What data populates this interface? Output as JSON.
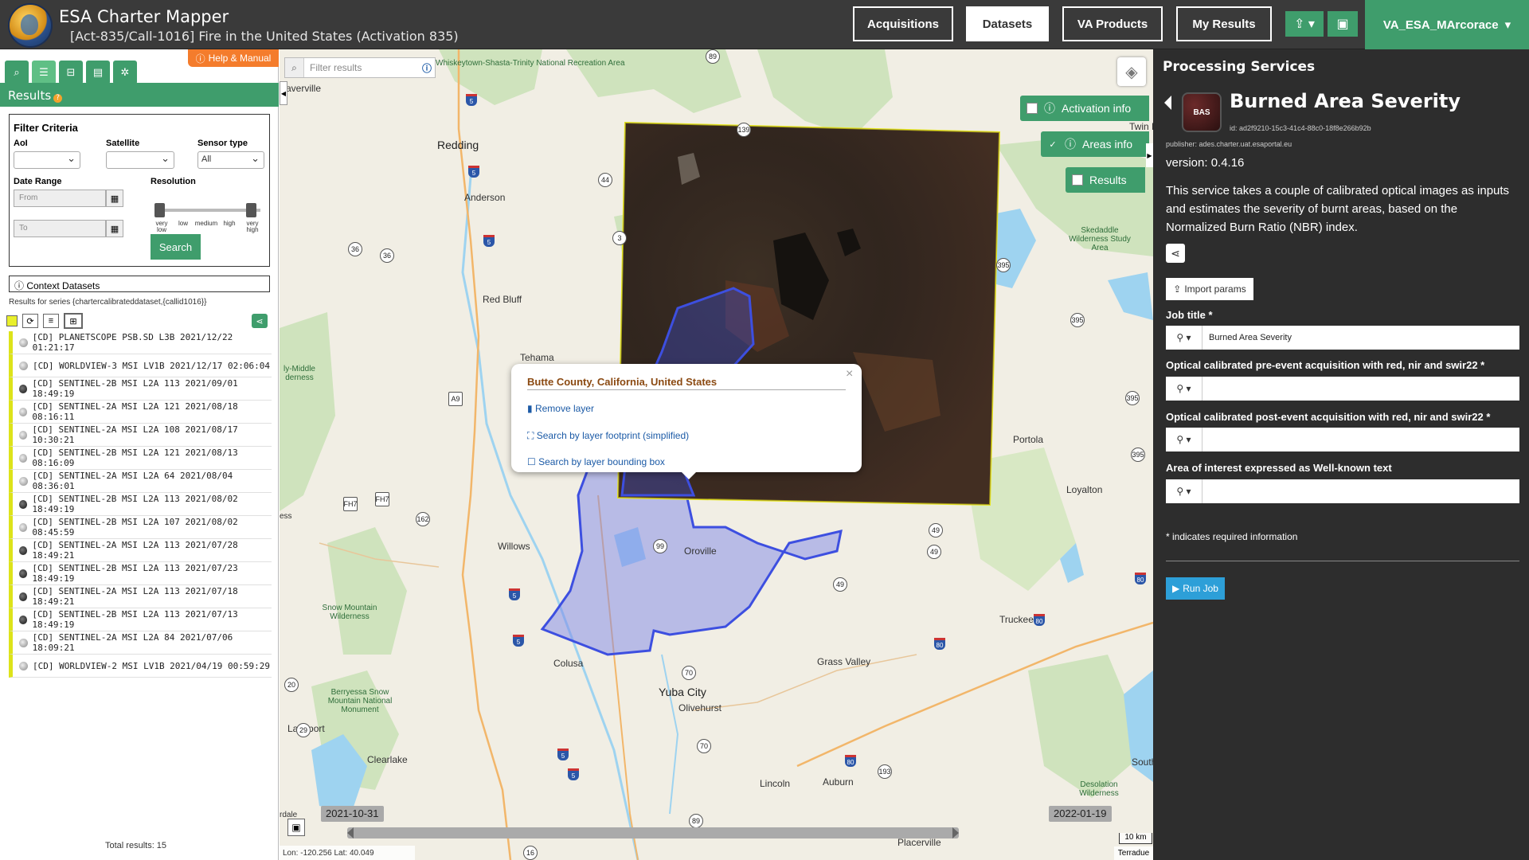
{
  "header": {
    "app_title": "ESA Charter Mapper",
    "activation_title": "[Act-835/Call-1016] Fire in the United States (Activation 835)",
    "nav": [
      "Acquisitions",
      "Datasets",
      "VA Products",
      "My Results"
    ],
    "active_nav": "Datasets",
    "upload_icon": "upload-icon",
    "briefcase_icon": "briefcase-icon",
    "user": "VA_ESA_MArcorace"
  },
  "left_panel": {
    "help_label": "Help & Manual",
    "results_label": "Results",
    "filter": {
      "title": "Filter Criteria",
      "aoi_label": "AoI",
      "satellite_label": "Satellite",
      "sensor_label": "Sensor type",
      "sensor_value": "All",
      "date_range_label": "Date Range",
      "from_placeholder": "From",
      "to_placeholder": "To",
      "resolution_label": "Resolution",
      "resolution_levels": [
        "very low",
        "low",
        "medium",
        "high",
        "very high"
      ],
      "search_label": "Search"
    },
    "context_title": "Context Datasets",
    "series_text": "Results for series {chartercalibrateddataset,{callid1016}}",
    "datasets": [
      {
        "label": "[CD] PLANETSCOPE PSB.SD L3B 2021/12/22 01:21:17",
        "dark": false
      },
      {
        "label": "[CD] WORLDVIEW-3 MSI LV1B 2021/12/17 02:06:04",
        "dark": false
      },
      {
        "label": "[CD] SENTINEL-2B MSI L2A 113 2021/09/01 18:49:19",
        "dark": true
      },
      {
        "label": "[CD] SENTINEL-2A MSI L2A 121 2021/08/18 08:16:11",
        "dark": false
      },
      {
        "label": "[CD] SENTINEL-2A MSI L2A 108 2021/08/17 10:30:21",
        "dark": false
      },
      {
        "label": "[CD] SENTINEL-2B MSI L2A 121 2021/08/13 08:16:09",
        "dark": false
      },
      {
        "label": "[CD] SENTINEL-2A MSI L2A 64 2021/08/04 08:36:01",
        "dark": false
      },
      {
        "label": "[CD] SENTINEL-2B MSI L2A 113 2021/08/02 18:49:19",
        "dark": true
      },
      {
        "label": "[CD] SENTINEL-2B MSI L2A 107 2021/08/02 08:45:59",
        "dark": false
      },
      {
        "label": "[CD] SENTINEL-2A MSI L2A 113 2021/07/28 18:49:21",
        "dark": true
      },
      {
        "label": "[CD] SENTINEL-2B MSI L2A 113 2021/07/23 18:49:19",
        "dark": true
      },
      {
        "label": "[CD] SENTINEL-2A MSI L2A 113 2021/07/18 18:49:21",
        "dark": true
      },
      {
        "label": "[CD] SENTINEL-2B MSI L2A 113 2021/07/13 18:49:19",
        "dark": true
      },
      {
        "label": "[CD] SENTINEL-2A MSI L2A 84 2021/07/06 18:09:21",
        "dark": false
      },
      {
        "label": "[CD] WORLDVIEW-2 MSI LV1B 2021/04/19 00:59:29",
        "dark": false
      }
    ],
    "total_results": "Total results: 15"
  },
  "map": {
    "filter_placeholder": "Filter results",
    "toggles": {
      "activation_info": "Activation info",
      "areas_info": "Areas info",
      "results": "Results"
    },
    "popup": {
      "title": "Butte County, California, United States",
      "remove_layer": "Remove layer",
      "search_footprint": "Search by layer footprint (simplified)",
      "search_bbox": "Search by layer bounding box"
    },
    "places": {
      "redding": "Redding",
      "anderson": "Anderson",
      "red_bluff": "Red Bluff",
      "tehama": "Tehama",
      "willows": "Willows",
      "oroville": "Oroville",
      "colusa": "Colusa",
      "yuba_city": "Yuba City",
      "olivehurst": "Olivehurst",
      "grass_valley": "Grass Valley",
      "lincoln": "Lincoln",
      "auburn": "Auburn",
      "placerville": "Placerville",
      "truckee": "Truckee",
      "portola": "Portola",
      "loyalton": "Loyalton",
      "clearlake": "Clearlake",
      "lakeport": "Lakeport",
      "anderville": "averville",
      "twin": "Twin P",
      "south": "South",
      "whiskeytown": "Whiskeytown-Shasta-Trinity National Recreation Area",
      "skedaddle": "Skedaddle Wilderness Study Area",
      "snow_mountain": "Snow Mountain Wilderness",
      "berryessa": "Berryessa Snow Mountain National Monument",
      "desolation": "Desolation Wilderness",
      "yolla": "ly-Middle derness",
      "ess": "ess",
      "rdale": "rdale"
    },
    "route_shields": [
      "89",
      "139",
      "44",
      "36",
      "36",
      "395",
      "395",
      "395",
      "395",
      "A9",
      "FH7",
      "FH7",
      "162",
      "99",
      "49",
      "49",
      "20",
      "29",
      "70",
      "70",
      "193",
      "16",
      "49",
      "89",
      "3"
    ],
    "interstate_shields": [
      "5",
      "5",
      "5",
      "5",
      "5",
      "80",
      "80",
      "80",
      "80",
      "5",
      "5"
    ],
    "timeline": {
      "start": "2021-10-31",
      "end": "2022-01-19"
    },
    "scale": "10 km",
    "coords": "Lon: -120.256 Lat: 40.049",
    "attribution": "Terradue",
    "colors": {
      "aoi_fill": "#7f88e8",
      "aoi_stroke": "#3d4fe0",
      "footprint_stroke": "#e6e61e"
    }
  },
  "right_panel": {
    "header": "Processing Services",
    "service": {
      "icon_text": "BAS",
      "title": "Burned Area Severity",
      "id": "id: ad2f9210-15c3-41c4-88c0-18f8e266b92b",
      "publisher": "publisher: ades.charter.uat.esaportal.eu",
      "version": "version: 0.4.16",
      "description": "This service takes a couple of calibrated optical images as inputs and estimates the severity of burnt areas, based on the Normalized Burn Ratio (NBR) index."
    },
    "import_label": "Import params",
    "params": [
      {
        "label": "Job title *",
        "value": "Burned Area Severity"
      },
      {
        "label": "Optical calibrated pre-event acquisition with red, nir and swir22 *",
        "value": ""
      },
      {
        "label": "Optical calibrated post-event acquisition with red, nir and swir22 *",
        "value": ""
      },
      {
        "label": "Area of interest expressed as Well-known text",
        "value": ""
      }
    ],
    "required_note": "* indicates required information",
    "run_label": "Run Job"
  },
  "colors": {
    "accent": "#3f9d6c",
    "topbar": "#3a3a3a",
    "right_bg": "#2d2d2d",
    "help": "#f47c2c",
    "run": "#2d9fd8"
  }
}
